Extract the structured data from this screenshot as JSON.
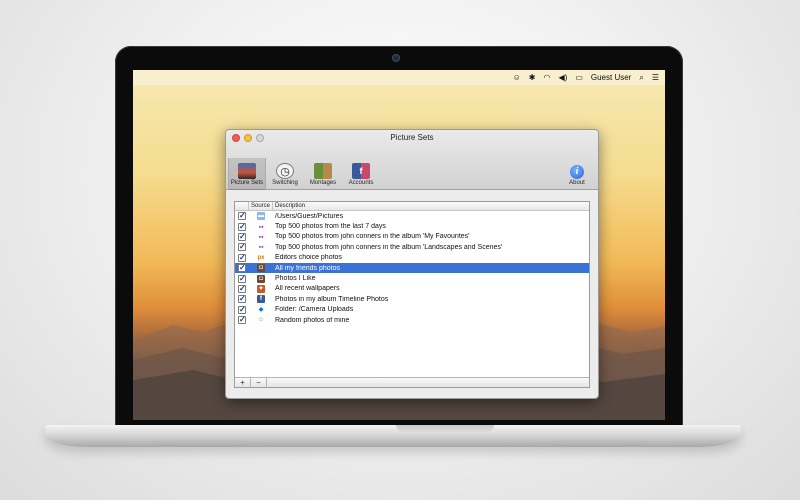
{
  "menubar": {
    "user": "Guest User",
    "icons": [
      "smiley-icon",
      "bluetooth-icon",
      "wifi-icon",
      "volume-icon",
      "battery-icon",
      "search-icon",
      "list-icon"
    ]
  },
  "window": {
    "title": "Picture Sets",
    "toolbar": [
      {
        "label": "Picture Sets",
        "icon": "picture-sets-icon",
        "active": true
      },
      {
        "label": "Switching",
        "icon": "clock-icon",
        "active": false
      },
      {
        "label": "Montages",
        "icon": "montage-icon",
        "active": false
      },
      {
        "label": "Accounts",
        "icon": "accounts-icon",
        "active": false
      }
    ],
    "about_label": "About"
  },
  "table": {
    "headers": {
      "source": "Source",
      "description": "Description"
    },
    "rows": [
      {
        "checked": true,
        "source": "folder",
        "description": "/Users/Guest/Pictures",
        "selected": false
      },
      {
        "checked": true,
        "source": "flickr",
        "description": "Top 500 photos from the last 7 days",
        "selected": false
      },
      {
        "checked": true,
        "source": "flickr",
        "description": "Top 500 photos from john conners in the album 'My Favourites'",
        "selected": false
      },
      {
        "checked": true,
        "source": "flickr",
        "description": "Top 500 photos from john conners in the album 'Landscapes and Scenes'",
        "selected": false
      },
      {
        "checked": true,
        "source": "500px",
        "description": "Editors choice photos",
        "selected": false
      },
      {
        "checked": true,
        "source": "instagram",
        "description": "All my friends photos",
        "selected": true
      },
      {
        "checked": true,
        "source": "instagram",
        "description": "Photos I Like",
        "selected": false
      },
      {
        "checked": true,
        "source": "wallpapers",
        "description": "All recent wallpapers",
        "selected": false
      },
      {
        "checked": true,
        "source": "facebook",
        "description": "Photos in my album Timeline Photos",
        "selected": false
      },
      {
        "checked": true,
        "source": "dropbox",
        "description": "Folder: /Camera Uploads",
        "selected": false
      },
      {
        "checked": true,
        "source": "random",
        "description": "Random photos of mine",
        "selected": false
      }
    ],
    "footer": {
      "add": "+",
      "remove": "−"
    }
  },
  "colors": {
    "selection": "#3b72d6",
    "flickr_blue": "#0063dc",
    "flickr_pink": "#ff0084",
    "facebook": "#3b5998",
    "dropbox": "#007ee5"
  }
}
